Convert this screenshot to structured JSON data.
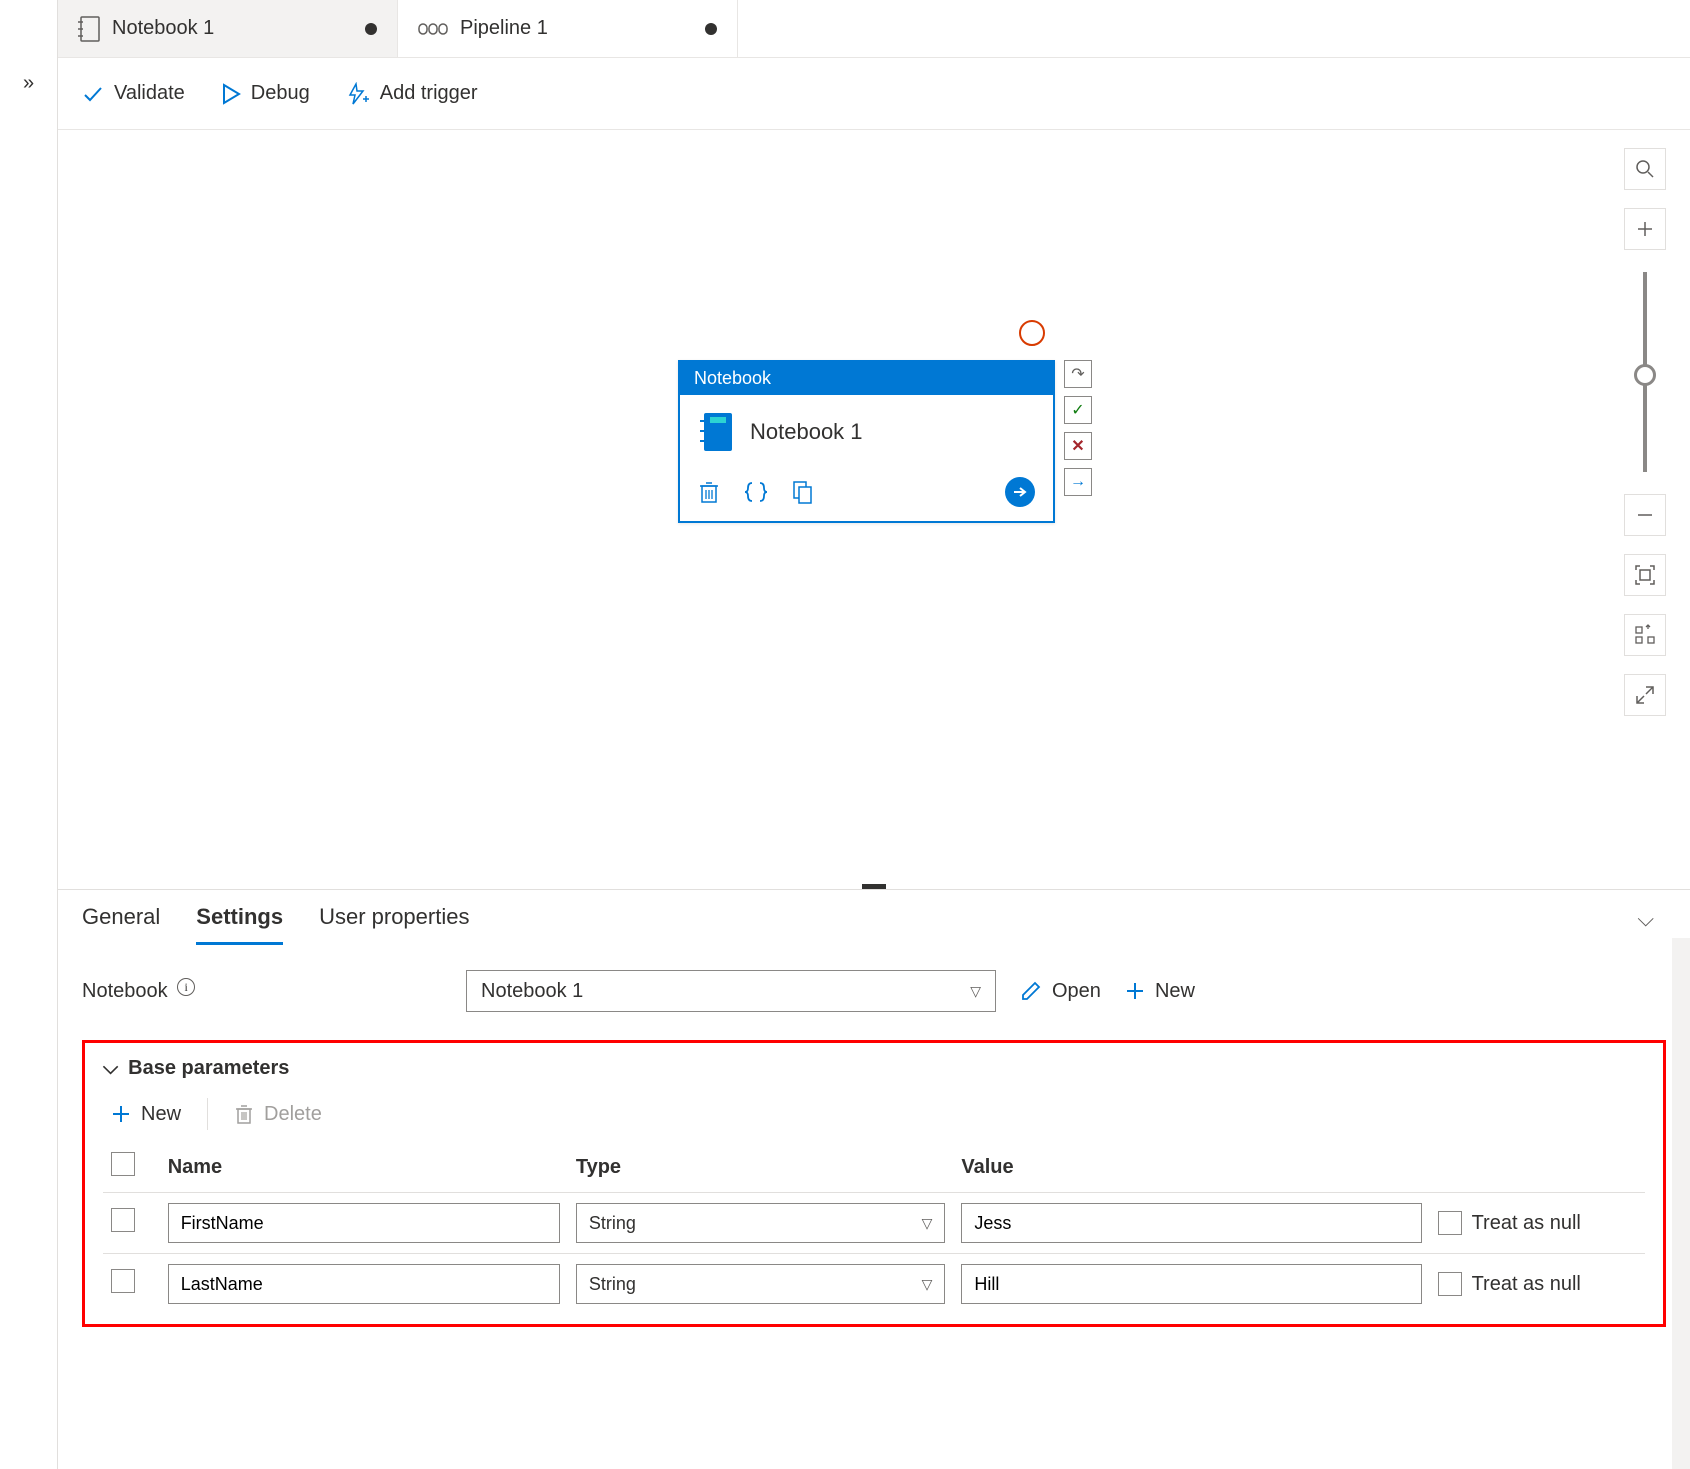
{
  "tabs": [
    {
      "label": "Notebook 1",
      "active": false,
      "dirty": true
    },
    {
      "label": "Pipeline 1",
      "active": true,
      "dirty": true
    }
  ],
  "toolbar": {
    "validate": "Validate",
    "debug": "Debug",
    "add_trigger": "Add trigger"
  },
  "node": {
    "type_label": "Notebook",
    "title": "Notebook 1",
    "handles": {
      "retry": "↷",
      "success": "✓",
      "fail": "✕",
      "skip": "→"
    }
  },
  "panel_tabs": {
    "general": "General",
    "settings": "Settings",
    "user_properties": "User properties"
  },
  "settings": {
    "notebook_label": "Notebook",
    "notebook_value": "Notebook 1",
    "open_label": "Open",
    "new_label": "New",
    "base_params_header": "Base parameters",
    "bp_new": "New",
    "bp_delete": "Delete",
    "columns": {
      "name": "Name",
      "type": "Type",
      "value": "Value"
    },
    "treat_as_null": "Treat as null",
    "rows": [
      {
        "name": "FirstName",
        "type": "String",
        "value": "Jess"
      },
      {
        "name": "LastName",
        "type": "String",
        "value": "Hill"
      }
    ]
  }
}
